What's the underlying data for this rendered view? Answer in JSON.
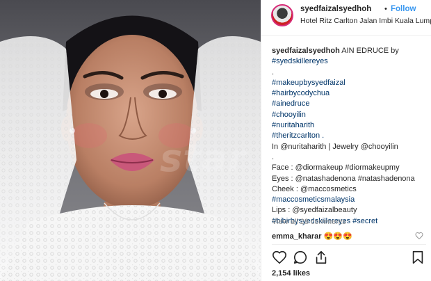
{
  "header": {
    "username": "syedfaizalsyedhoh",
    "dot": "•",
    "follow_label": "Follow",
    "location": "Hotel Ritz Carlton Jalan Imbi Kuala Lumpur"
  },
  "watermark": "star",
  "caption": {
    "username": "syedfaizalsyedhoh",
    "title": "AIN EDRUCE by",
    "lines": [
      "#syedskillereyes",
      ".",
      "#makeupbysyedfaizal",
      "#hairbycodychua",
      "#ainedruce",
      "#chooyilin",
      "#nuritaharith",
      "#theritzcarlton .",
      "In @nuritaharith | Jewelry @chooyilin",
      ".",
      "Face : @diormakeup #diormakeupmy",
      "Eyes : @natashadenona #natashadenona",
      "Cheek : @maccosmetics",
      "#maccosmeticsmalaysia",
      "Lips : @syedfaizalbeauty",
      "#bibirbysyedskillereyes #secret"
    ]
  },
  "view_all_comments": "View all 28 comments",
  "comment": {
    "username": "emma_kharar",
    "text": "😍😍😍"
  },
  "actions": {
    "like_icon": "heart-icon",
    "comment_icon": "comment-icon",
    "share_icon": "share-icon",
    "save_icon": "bookmark-icon"
  },
  "likes": "2,154 likes",
  "colors": {
    "link": "#003569",
    "follow": "#3897f0",
    "muted": "#999999",
    "text": "#262626"
  }
}
